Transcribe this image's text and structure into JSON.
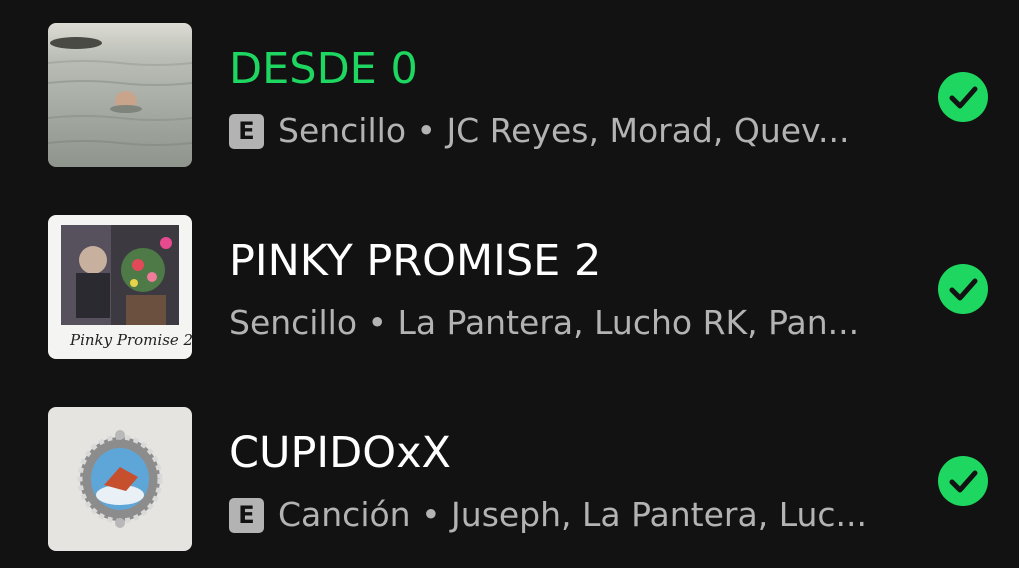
{
  "colors": {
    "background": "#121212",
    "accent": "#1ed760",
    "title": "#ffffff",
    "subtitle": "#b3b3b3"
  },
  "items": [
    {
      "title": "DESDE 0",
      "explicit_label": "E",
      "subtitle": "Sencillo • JC Reyes, Morad, Quev...",
      "status_icon": "downloaded-check-icon"
    },
    {
      "title": "PINKY PROMISE 2",
      "subtitle": "Sencillo • La Pantera, Lucho RK, Pan...",
      "cover_text": "Pinky Promise 2★",
      "status_icon": "downloaded-check-icon"
    },
    {
      "title": "CUPIDOxX",
      "explicit_label": "E",
      "subtitle": "Canción • Juseph, La Pantera, Luc...",
      "status_icon": "downloaded-check-icon"
    }
  ]
}
